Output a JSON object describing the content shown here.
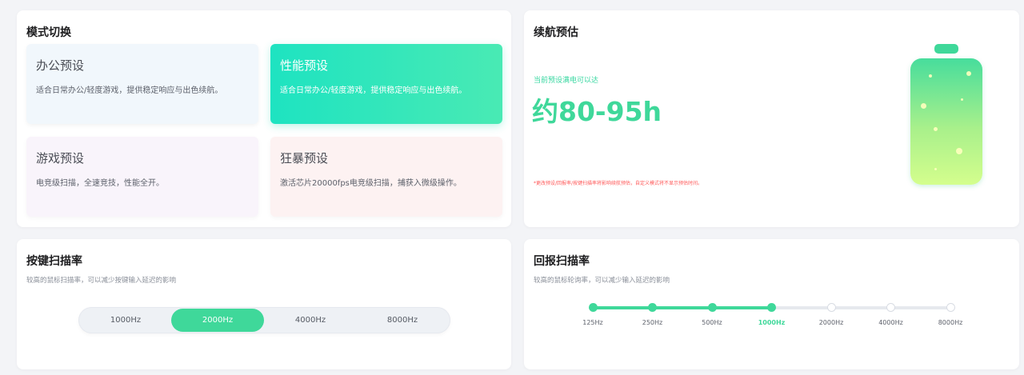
{
  "mode": {
    "title": "模式切换",
    "presets": [
      {
        "name": "办公预设",
        "desc": "适合日常办公/轻度游戏，提供稳定响应与出色续航。",
        "selected": false
      },
      {
        "name": "性能预设",
        "desc": "适合日常办公/轻度游戏，提供稳定响应与出色续航。",
        "selected": true
      },
      {
        "name": "游戏预设",
        "desc": "电竞级扫描，全速竞技，性能全开。",
        "selected": false
      },
      {
        "name": "狂暴预设",
        "desc": "激活芯片20000fps电竞级扫描，捕获入微级操作。",
        "selected": false
      }
    ]
  },
  "battery": {
    "title": "续航预估",
    "label": "当前预设满电可以达",
    "value": "约80-95h",
    "note": "*更改预设/回报率/按键扫描率将影响续航预估，自定义模式将不显示预估时间。",
    "colors": {
      "accent": "#3fd89a",
      "note": "#ff5a5a"
    }
  },
  "scan": {
    "title": "按键扫描率",
    "subtitle": "较高的鼠标扫描率，可以减少按键输入延迟的影响",
    "options": [
      "1000Hz",
      "2000Hz",
      "4000Hz",
      "8000Hz"
    ],
    "selected": "2000Hz"
  },
  "report": {
    "title": "回报扫描率",
    "subtitle": "较高的鼠标轮询率，可以减少输入延迟的影响",
    "options": [
      "125Hz",
      "250Hz",
      "500Hz",
      "1000Hz",
      "2000Hz",
      "4000Hz",
      "8000Hz"
    ],
    "selected": "1000Hz"
  },
  "colors": {
    "accent": "#3fd89a",
    "background": "#f3f4f7",
    "card": "#ffffff"
  }
}
